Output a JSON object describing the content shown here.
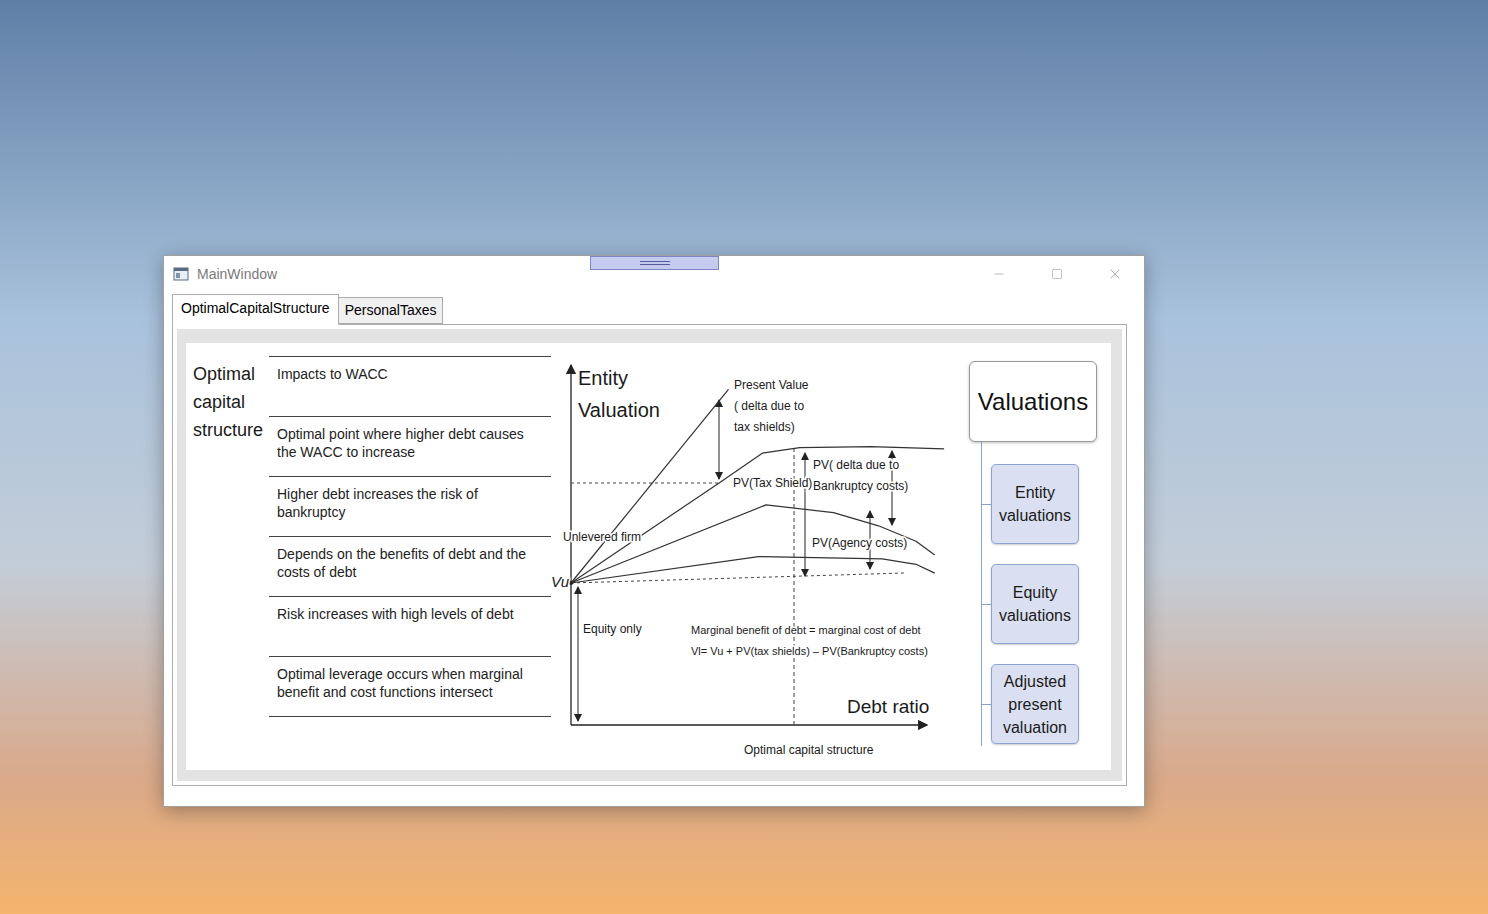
{
  "window": {
    "title": "MainWindow"
  },
  "tabs": [
    {
      "label": "OptimalCapitalStructure",
      "selected": true
    },
    {
      "label": "PersonalTaxes",
      "selected": false
    }
  ],
  "table": {
    "heading": "Optimal capital structure",
    "rows": [
      "Impacts to WACC",
      "Optimal point where higher debt causes the WACC to increase",
      "Higher debt increases the risk of bankruptcy",
      "Depends on the benefits of debt and the costs of debt",
      "Risk increases with high levels of debt",
      "Optimal leverage occurs when marginal benefit and cost functions intersect"
    ]
  },
  "chart": {
    "y_label": [
      "Entity",
      "Valuation"
    ],
    "x_label": "Debt ratio",
    "x_caption": "Optimal capital structure",
    "origin_label": "Vu",
    "tax_shield_pv": [
      "Present Value",
      "( delta due to",
      "tax shields)"
    ],
    "pv_tax_shield": "PV(Tax Shield)",
    "bankruptcy": [
      "PV( delta due to",
      "Bankruptcy costs)"
    ],
    "unlevered": "Unlevered firm",
    "agency": "PV(Agency costs)",
    "equity_only": "Equity only",
    "optimum": [
      "Marginal benefit of debt = marginal cost of debt",
      "Vl= Vu + PV(tax shields) – PV(Bankruptcy costs)"
    ],
    "series": [
      {
        "points": [
          [
            0,
            0
          ],
          [
            42,
            88
          ]
        ]
      },
      {
        "points": [
          [
            0,
            0
          ],
          [
            39.5,
            45.5
          ],
          [
            51,
            59
          ],
          [
            61,
            61.5
          ],
          [
            80,
            62
          ],
          [
            99.5,
            61
          ]
        ]
      },
      {
        "points": [
          [
            0,
            0
          ],
          [
            52,
            35.5
          ],
          [
            70,
            32
          ],
          [
            82,
            26
          ],
          [
            92,
            19
          ],
          [
            97,
            12.7
          ]
        ]
      },
      {
        "points": [
          [
            0,
            0
          ],
          [
            50,
            12
          ],
          [
            83,
            11
          ],
          [
            92,
            8.5
          ],
          [
            97,
            4.5
          ]
        ]
      }
    ]
  },
  "valuations": {
    "title": "Valuations",
    "items": [
      "Entity valuations",
      "Equity valuations",
      "Adjusted present valuation"
    ]
  }
}
